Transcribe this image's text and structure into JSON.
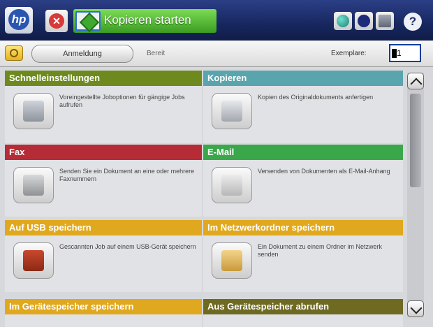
{
  "header": {
    "logo_text": "hp",
    "start_label": "Kopieren starten",
    "help_symbol": "?",
    "stop_symbol": "✕"
  },
  "subbar": {
    "signin_label": "Anmeldung",
    "status": "Bereit",
    "copies_label": "Exemplare:",
    "copies_value": "1"
  },
  "tiles": [
    {
      "title": "Schnelleinstellungen",
      "desc": "Voreingestellte Joboptionen für gängige Jobs aufrufen",
      "color": "#6e8a1e",
      "icon": "clipboard-icon"
    },
    {
      "title": "Kopieren",
      "desc": "Kopien des Originaldokuments anfertigen",
      "color": "#5aa5ad",
      "icon": "copy-icon"
    },
    {
      "title": "Fax",
      "desc": "Senden Sie ein Dokument an eine oder mehrere Faxnummern",
      "color": "#b52c36",
      "icon": "fax-icon"
    },
    {
      "title": "E-Mail",
      "desc": "Versenden von Dokumenten als E-Mail-Anhang",
      "color": "#3aa84a",
      "icon": "envelope-icon"
    },
    {
      "title": "Auf USB speichern",
      "desc": "Gescannten Job auf einem USB-Gerät speichern",
      "color": "#e0a81e",
      "icon": "usb-icon"
    },
    {
      "title": "Im Netzwerkordner speichern",
      "desc": "Ein Dokument zu einem Ordner im Netzwerk senden",
      "color": "#e0a81e",
      "icon": "folder-icon"
    },
    {
      "title": "Im Gerätespeicher speichern",
      "desc": "",
      "color": "#e0a81e",
      "icon": ""
    },
    {
      "title": "Aus Gerätespeicher abrufen",
      "desc": "",
      "color": "#6e6a22",
      "icon": ""
    }
  ],
  "status_icons": [
    {
      "name": "network-icon",
      "color": "#2e9b8f"
    },
    {
      "name": "sleep-icon",
      "color": "#1c2c78"
    },
    {
      "name": "device-info-icon",
      "color": "#7f8796"
    }
  ]
}
